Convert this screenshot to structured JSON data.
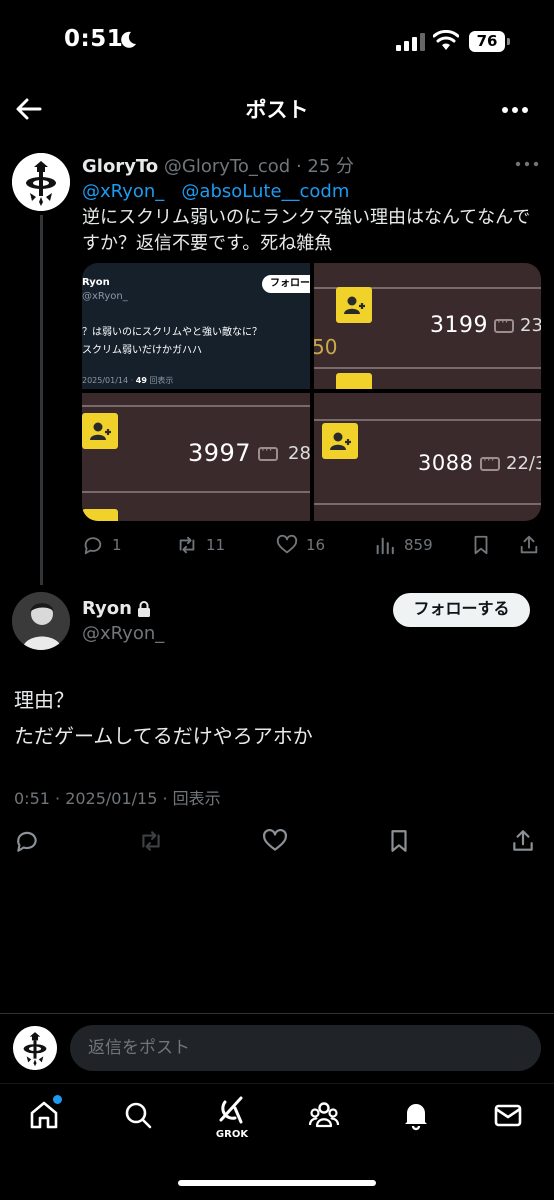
{
  "status_bar": {
    "time": "0:51",
    "battery": "76",
    "icons": [
      "moon-icon",
      "signal-icon",
      "wifi-icon",
      "battery-icon"
    ]
  },
  "header": {
    "title": "ポスト",
    "icons": [
      "back-arrow-icon",
      "more-icon"
    ]
  },
  "parent_post": {
    "display_name": "GloryTo",
    "handle": "@GloryTo_cod",
    "time_ago": "· 25 分",
    "mentions": [
      "@xRyon_",
      "@absoLute__codm"
    ],
    "text": "逆にスクリム弱いのにランクマ強い理由はなんてなんですか？返信不要です。死ね雑魚",
    "media": {
      "embedded_post": {
        "name": "Ryon",
        "handle": "@xRyon_",
        "follow_label": "フォロー",
        "line1": "？は弱いのにスクリムやと強い敵なに？",
        "line2": "スクリム弱いだけかガハハ",
        "date": "2025/01/14 ·",
        "views": "49",
        "views_suffix": "回表示"
      },
      "scores": [
        {
          "value": "3199",
          "suffix": "23,"
        },
        {
          "value": "3997",
          "suffix": "28"
        },
        {
          "value": "3088",
          "suffix": "22/3"
        }
      ],
      "partial_number": "50"
    },
    "actions": {
      "replies": "1",
      "reposts": "11",
      "likes": "16",
      "views": "859"
    }
  },
  "main_post": {
    "display_name": "Ryon",
    "handle": "@xRyon_",
    "follow_label": "フォローする",
    "text_line1": "理由？",
    "text_line2": "ただゲームしてるだけやろアホか",
    "meta": "0:51 · 2025/01/15 · 回表示"
  },
  "reply_bar": {
    "placeholder": "返信をポスト"
  },
  "tab_bar": {
    "items": [
      "home",
      "search",
      "grok",
      "communities",
      "notifications",
      "messages"
    ],
    "grok_label": "GROK",
    "accent_color": "#1d9bf0"
  },
  "colors": {
    "background": "#000000",
    "text": "#e7e9ea",
    "secondary": "#71767b",
    "accent": "#1d9bf0"
  }
}
